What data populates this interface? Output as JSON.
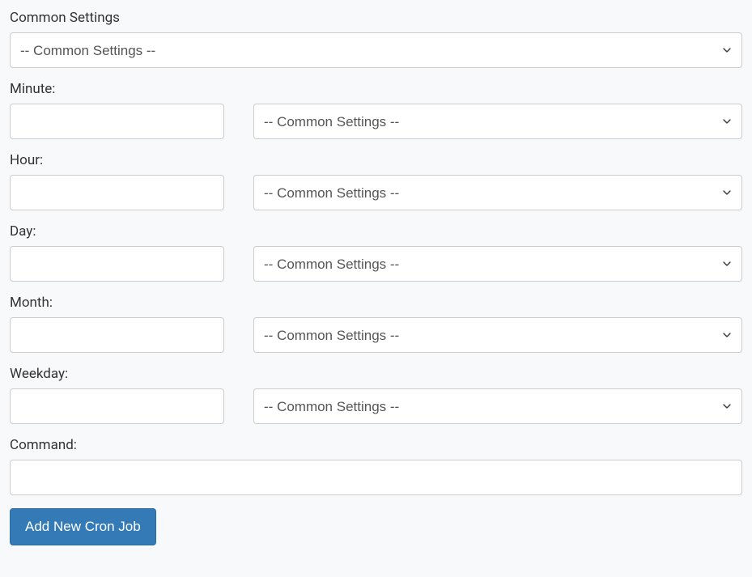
{
  "common": {
    "label": "Common Settings",
    "option": "-- Common Settings --"
  },
  "minute": {
    "label": "Minute:",
    "value": "",
    "select_option": "-- Common Settings --"
  },
  "hour": {
    "label": "Hour:",
    "value": "",
    "select_option": "-- Common Settings --"
  },
  "day": {
    "label": "Day:",
    "value": "",
    "select_option": "-- Common Settings --"
  },
  "month": {
    "label": "Month:",
    "value": "",
    "select_option": "-- Common Settings --"
  },
  "weekday": {
    "label": "Weekday:",
    "value": "",
    "select_option": "-- Common Settings --"
  },
  "command": {
    "label": "Command:",
    "value": ""
  },
  "submit": {
    "label": "Add New Cron Job"
  }
}
